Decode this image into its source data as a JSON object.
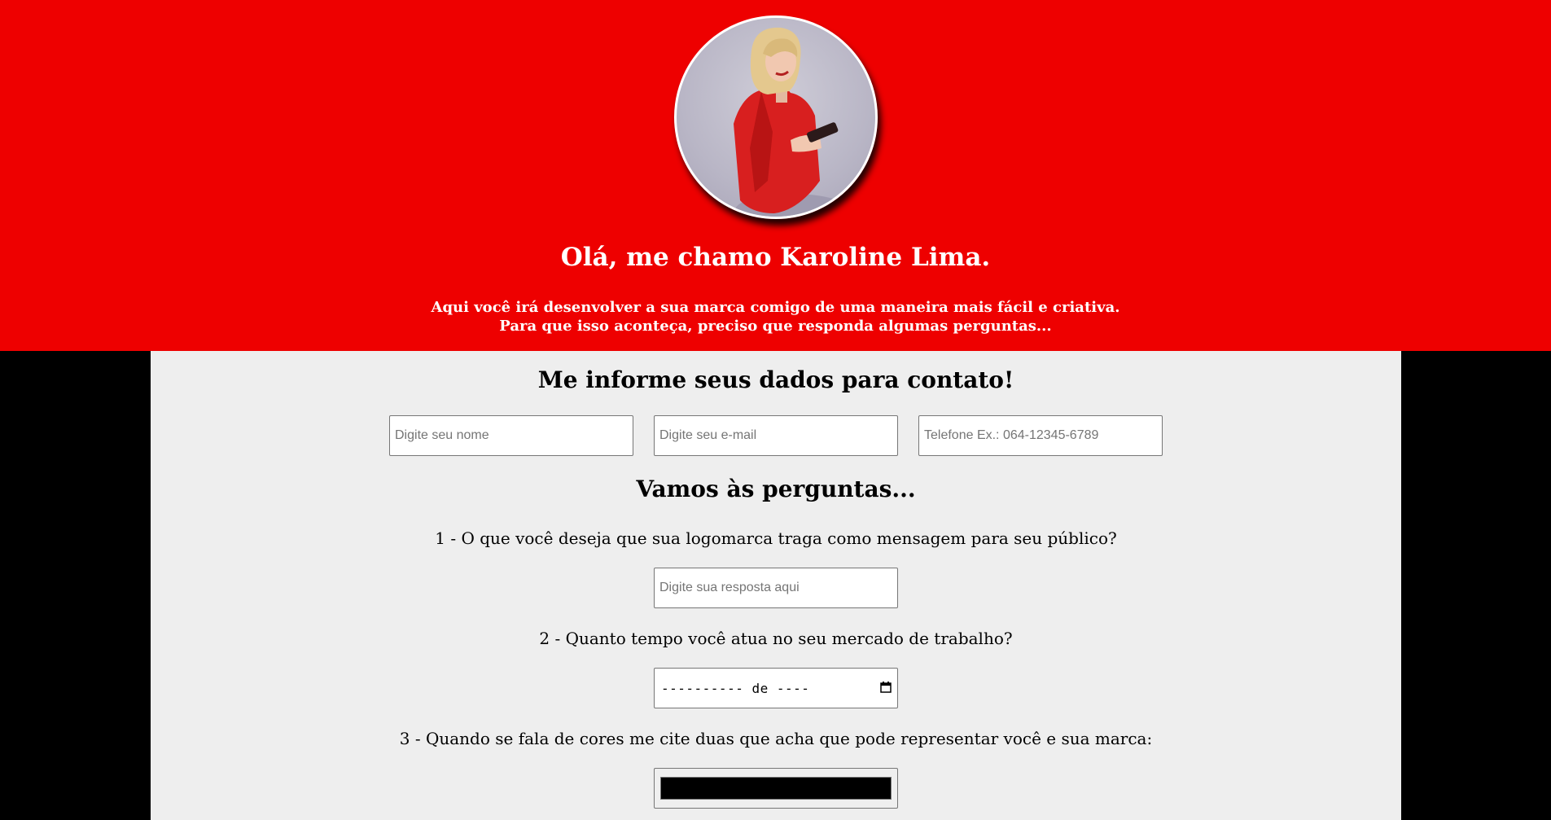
{
  "colors": {
    "header_bg": "#ee0000",
    "page_bg": "#000000",
    "main_bg": "#eeeeee",
    "color_input_value": "#000000"
  },
  "header": {
    "title": "Olá, me chamo Karoline Lima.",
    "intro_line1": "Aqui você irá desenvolver a sua marca comigo de uma maneira mais fácil e criativa.",
    "intro_line2": "Para que isso aconteça, preciso que responda algumas perguntas..."
  },
  "contact": {
    "heading": "Me informe seus dados para contato!",
    "name_placeholder": "Digite seu nome",
    "email_placeholder": "Digite seu e-mail",
    "phone_placeholder": "Telefone Ex.: 064-12345-6789"
  },
  "questions": {
    "heading": "Vamos às perguntas...",
    "q1": "1 - O que você deseja que sua logomarca traga como mensagem para seu público?",
    "q1_placeholder": "Digite sua resposta aqui",
    "q2": "2 - Quanto tempo você atua no seu mercado de trabalho?",
    "q2_month_value": "---------- de ----",
    "q3": "3 - Quando se fala de cores me cite duas que acha que pode representar você e sua marca:"
  },
  "icons": {
    "date_picker": "calendar-icon",
    "avatar": "profile-photo"
  }
}
